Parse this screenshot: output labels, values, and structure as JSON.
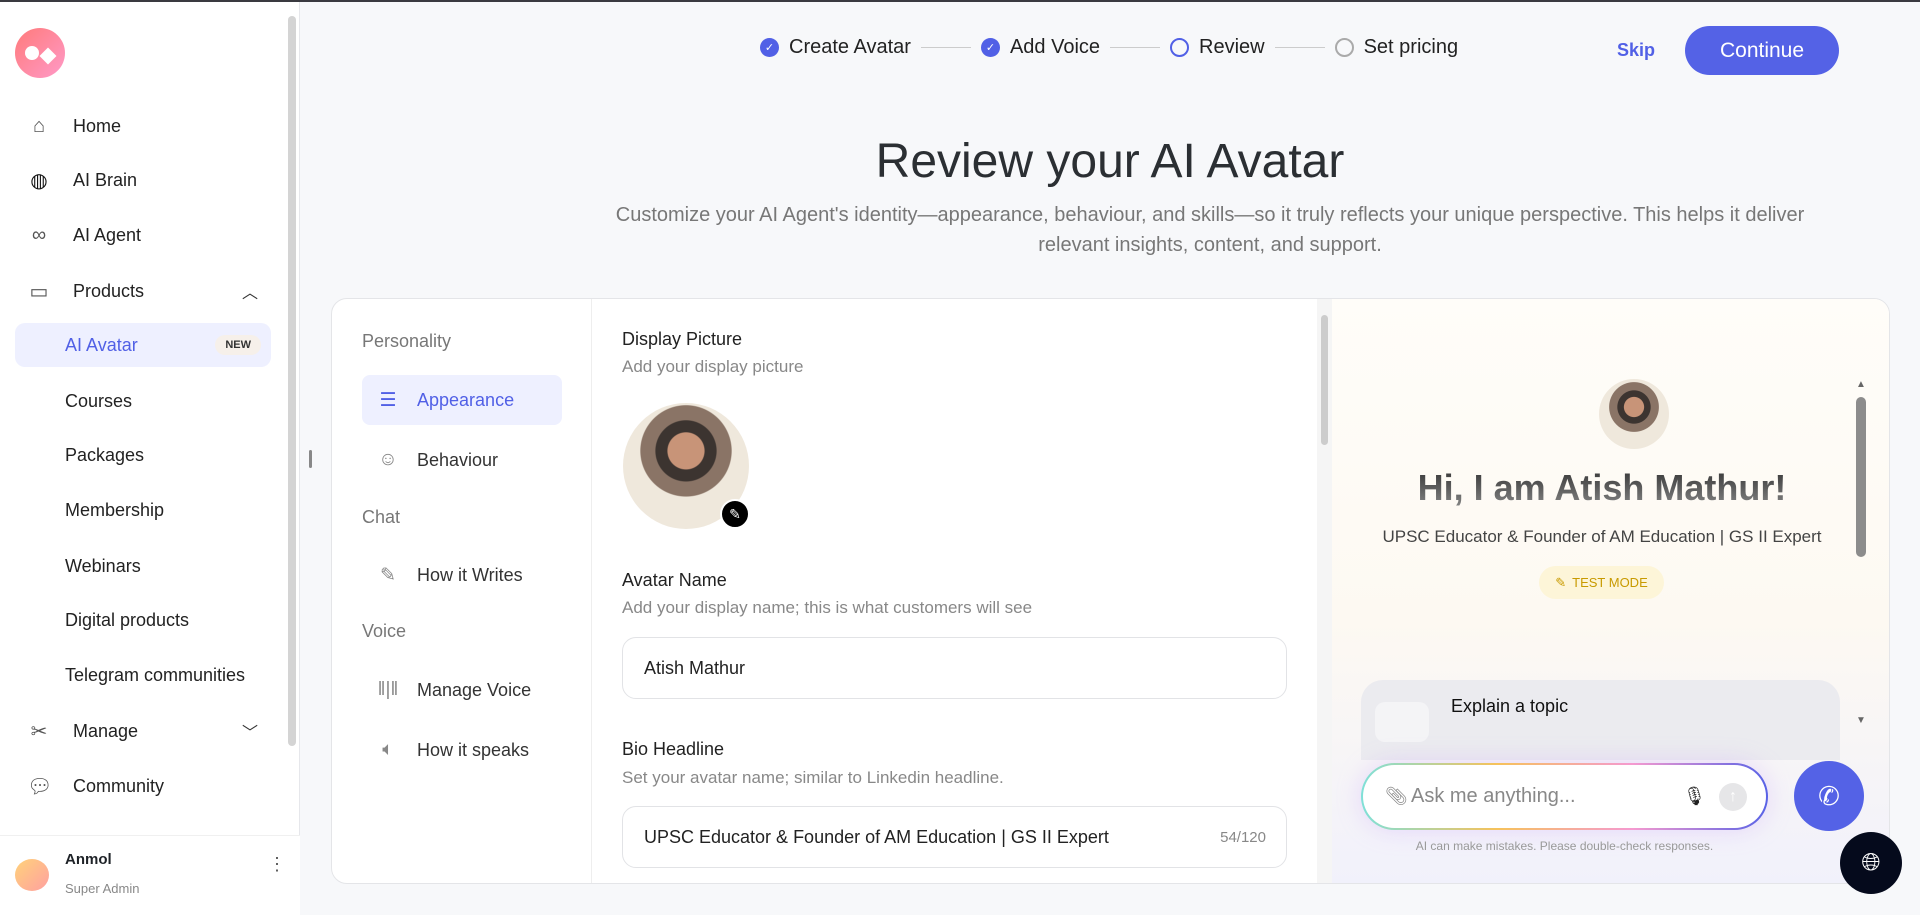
{
  "sidebar": {
    "items": [
      {
        "label": "Home",
        "icon": "home-icon"
      },
      {
        "label": "AI Brain",
        "icon": "brain-icon"
      },
      {
        "label": "AI Agent",
        "icon": "infinity-icon"
      },
      {
        "label": "Products",
        "icon": "archive-icon"
      }
    ],
    "products_sub": [
      "AI Avatar",
      "Courses",
      "Packages",
      "Membership",
      "Webinars",
      "Digital products",
      "Telegram communities"
    ],
    "new_badge": "NEW",
    "manage": "Manage",
    "community": "Community",
    "user": {
      "name": "Anmol",
      "role": "Super Admin"
    }
  },
  "stepper": [
    {
      "label": "Create Avatar",
      "state": "done"
    },
    {
      "label": "Add Voice",
      "state": "done"
    },
    {
      "label": "Review",
      "state": "current"
    },
    {
      "label": "Set pricing",
      "state": "todo"
    }
  ],
  "header": {
    "skip": "Skip",
    "continue": "Continue"
  },
  "page": {
    "title": "Review your AI Avatar",
    "subtitle": "Customize your AI Agent's identity—appearance, behaviour, and skills—so it truly reflects your unique perspective. This helps it deliver relevant insights, content, and support."
  },
  "settings_nav": {
    "personality": "Personality",
    "appearance": "Appearance",
    "behaviour": "Behaviour",
    "chat": "Chat",
    "how_writes": "How it Writes",
    "voice": "Voice",
    "manage_voice": "Manage Voice",
    "how_speaks": "How it speaks"
  },
  "form": {
    "display_picture": {
      "label": "Display Picture",
      "help": "Add your display picture"
    },
    "avatar_name": {
      "label": "Avatar Name",
      "help": "Add your display name; this is what customers will see",
      "value": "Atish Mathur"
    },
    "bio": {
      "label": "Bio Headline",
      "help": "Set your avatar name; similar to Linkedin headline.",
      "value": "UPSC Educator & Founder of AM Education | GS II Expert",
      "count": "54/120"
    }
  },
  "preview": {
    "greeting": "Hi, I am Atish Mathur!",
    "headline": "UPSC Educator & Founder of AM Education | GS II Expert",
    "test_mode": "TEST MODE",
    "suggestion": "Explain a topic",
    "placeholder": "Ask me anything...",
    "disclaimer": "AI can make mistakes. Please double-check responses."
  },
  "colors": {
    "accent": "#5462e6"
  }
}
